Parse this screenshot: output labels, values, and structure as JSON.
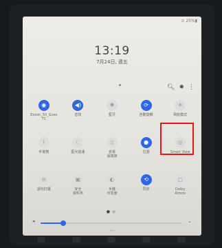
{
  "status_bar": {
    "battery": "⊙ 25%▮"
  },
  "lockscreen": {
    "time": "13:19",
    "date": "7月24日, 週五"
  },
  "toolbar": {
    "search_icon": "search-icon",
    "settings_icon": "gear-icon",
    "more_icon": "more-icon"
  },
  "tiles": [
    {
      "label": "Epson_50_Gues\nT1",
      "icon": "wifi-icon",
      "glyph": "◉",
      "active": true
    },
    {
      "label": "音效",
      "icon": "speaker-icon",
      "glyph": "◀)",
      "active": true
    },
    {
      "label": "藍牙",
      "icon": "bluetooth-icon",
      "glyph": "✱",
      "active": false
    },
    {
      "label": "自動旋轉",
      "icon": "rotate-icon",
      "glyph": "⟳",
      "active": true
    },
    {
      "label": "飛航模式",
      "icon": "airplane-icon",
      "glyph": "✈",
      "active": false
    },
    {
      "label": "手電筒",
      "icon": "flashlight-icon",
      "glyph": "Ⅰ",
      "active": false
    },
    {
      "label": "藍光過濾",
      "icon": "blue-light-icon",
      "glyph": "☾",
      "active": false
    },
    {
      "label": "省電\n遠端接",
      "icon": "power-saving-icon",
      "glyph": "▯",
      "active": false
    },
    {
      "label": "位置",
      "icon": "location-icon",
      "glyph": "●",
      "active": true
    },
    {
      "label": "Smart View",
      "icon": "smart-view-icon",
      "glyph": "◎",
      "active": false
    },
    {
      "label": "請勿打擾",
      "icon": "do-not-disturb-icon",
      "glyph": "⊖",
      "active": false
    },
    {
      "label": "安全\n資料夾",
      "icon": "secure-folder-icon",
      "glyph": "▣",
      "active": false
    },
    {
      "label": "手機\n可見度",
      "icon": "phone-visibility-icon",
      "glyph": "◐",
      "active": false
    },
    {
      "label": "同步",
      "icon": "sync-icon",
      "glyph": "⟲",
      "active": true
    },
    {
      "label": "Dolby\nAtmos",
      "icon": "dolby-icon",
      "glyph": "▢",
      "active": false
    }
  ],
  "pager": {
    "current": "●",
    "other": "●"
  },
  "volume": {
    "level": 0.16,
    "icon": "volume-icon",
    "chevron": "⌄"
  },
  "handle": "—"
}
